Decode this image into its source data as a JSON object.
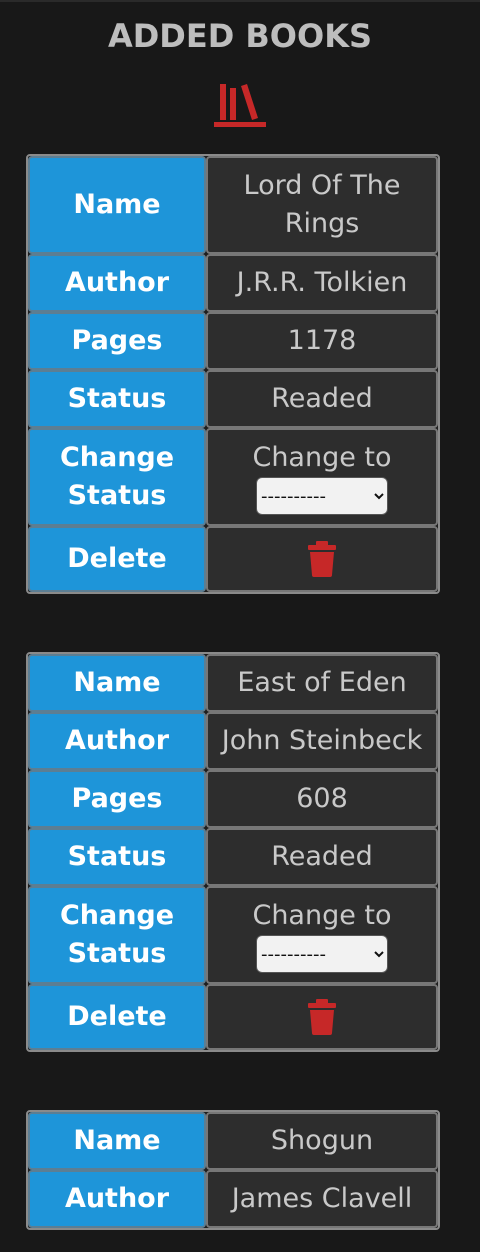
{
  "title": "ADDED BOOKS",
  "colors": {
    "accent": "#1e95d9",
    "danger": "#c62828",
    "background": "#181818"
  },
  "labels": {
    "name": "Name",
    "author": "Author",
    "pages": "Pages",
    "status": "Status",
    "change_status": "Change Status",
    "delete": "Delete",
    "change_to": "Change to"
  },
  "select": {
    "selected": "----------"
  },
  "books": [
    {
      "name": "Lord Of The Rings",
      "author": "J.R.R. Tolkien",
      "pages": "1178",
      "status": "Readed"
    },
    {
      "name": "East of Eden",
      "author": "John Steinbeck",
      "pages": "608",
      "status": "Readed"
    },
    {
      "name": "Shogun",
      "author": "James Clavell"
    }
  ]
}
